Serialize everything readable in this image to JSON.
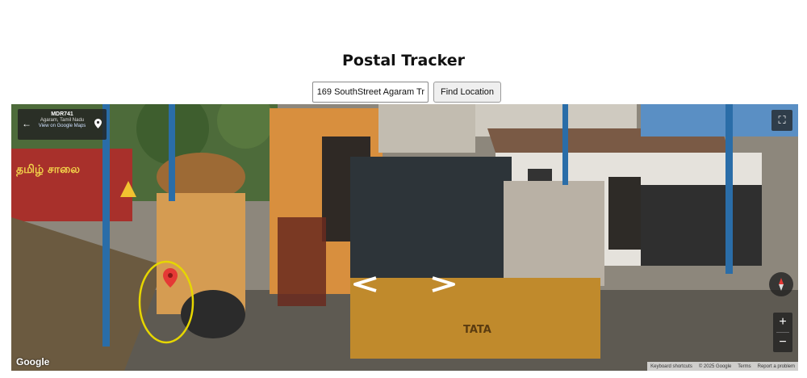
{
  "header": {
    "title": "Postal Tracker"
  },
  "search": {
    "address_value": "169 SouthStreet Agaram Tr",
    "button_label": "Find Location"
  },
  "street_view": {
    "info_card": {
      "title": "MDR741",
      "subtitle": "Agaram, Tamil Nadu",
      "link": "View on Google Maps"
    },
    "branding": "Google",
    "footer": {
      "shortcuts": "Keyboard shortcuts",
      "copyright": "© 2025 Google",
      "terms": "Terms",
      "report": "Report a problem"
    },
    "controls": {
      "zoom_in": "+",
      "zoom_out": "−",
      "fullscreen": "⛶"
    },
    "sign_text": "தமிழ் சாலை",
    "truck_brand": "TATA",
    "colors": {
      "marker": "#e53935",
      "annotation_circle": "#e6d600",
      "poles": "#2a6da8"
    }
  }
}
